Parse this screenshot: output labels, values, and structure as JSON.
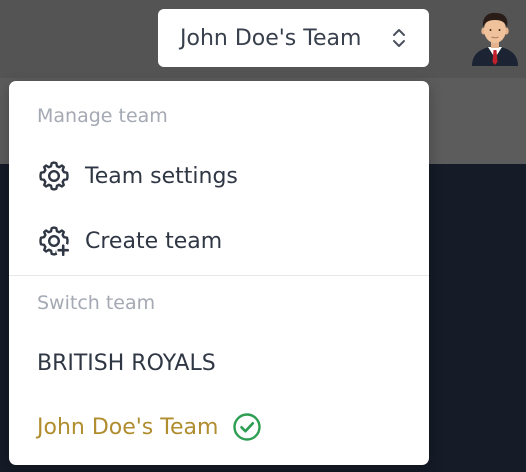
{
  "header": {
    "team_switcher_label": "John Doe's Team",
    "avatar_icon": "user-avatar-icon"
  },
  "dropdown": {
    "manage_section_label": "Manage team",
    "manage_items": [
      {
        "label": "Team settings",
        "icon": "gear-icon"
      },
      {
        "label": "Create team",
        "icon": "gear-plus-icon"
      }
    ],
    "switch_section_label": "Switch team",
    "teams": [
      {
        "label": "BRITISH ROYALS",
        "active": false
      },
      {
        "label": "John Doe's Team",
        "active": true,
        "icon": "check-circle-icon"
      }
    ]
  },
  "colors": {
    "active_team_text": "#b08d2f",
    "check_green": "#2e9e52",
    "header_bg": "#545454",
    "content_bg": "#151b27"
  }
}
